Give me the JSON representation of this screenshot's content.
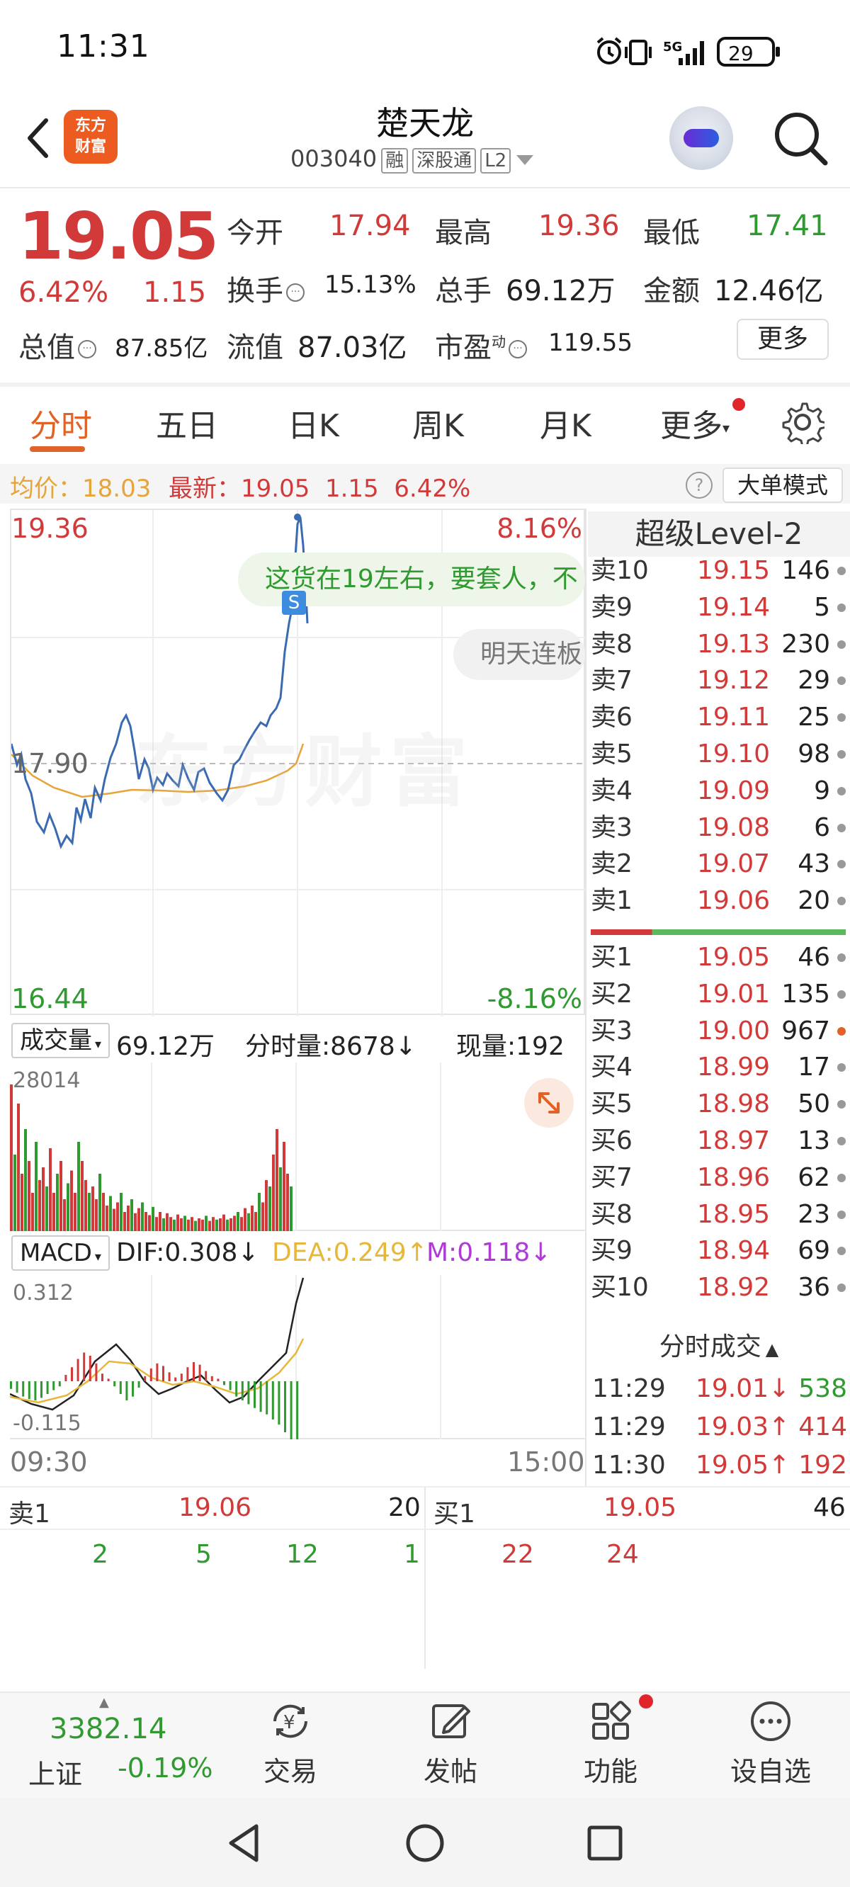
{
  "status_bar": {
    "time": "11:31",
    "network": "5G",
    "battery": "29"
  },
  "header": {
    "logo_text": "东方财富",
    "stock_name": "楚天龙",
    "stock_code": "003040",
    "tags": [
      "融",
      "深股通",
      "L2"
    ]
  },
  "quote": {
    "price": "19.05",
    "change_pct": "6.42%",
    "change_amt": "1.15",
    "open_label": "今开",
    "open": "17.94",
    "high_label": "最高",
    "high": "19.36",
    "low_label": "最低",
    "low": "17.41",
    "turnover_label": "换手",
    "turnover": "15.13%",
    "volume_label": "总手",
    "volume": "69.12万",
    "amount_label": "金额",
    "amount": "12.46亿",
    "mktcap_label": "总值",
    "mktcap": "87.85亿",
    "float_label": "流值",
    "float_cap": "87.03亿",
    "pe_label": "市盈",
    "pe_sup": "动",
    "pe": "119.55",
    "more_label": "更多"
  },
  "tabs": [
    "分时",
    "五日",
    "日K",
    "周K",
    "月K",
    "更多"
  ],
  "info_line": {
    "avg_label": "均价：18.03",
    "latest_label": "最新：",
    "latest": "19.05",
    "change": "1.15",
    "pct": "6.42%",
    "help": "?",
    "big_order_label": "大单模式"
  },
  "intraday_chart": {
    "y_top": "19.36",
    "y_top_pct": "8.16%",
    "y_mid": "17.90",
    "y_bottom": "16.44",
    "y_bottom_pct": "-8.16%",
    "watermark": "东方财富",
    "comment1": "这货在19左右，要套人，不",
    "comment2": "明天连板",
    "marker": "S"
  },
  "volume_panel": {
    "selector": "成交量",
    "total": "69.12万",
    "minute_label": "分时量:8678↓",
    "now_label": "现量:192",
    "max": "28014"
  },
  "macd_panel": {
    "selector": "MACD",
    "dif": "DIF:0.308↓",
    "dea": "DEA:0.249↑",
    "m": "M:0.118↓",
    "max": "0.312",
    "min": "-0.115"
  },
  "time_axis": {
    "start": "09:30",
    "end": "15:00"
  },
  "level2": {
    "title": "超级Level-2",
    "asks": [
      {
        "label": "卖10",
        "price": "19.15",
        "qty": "146"
      },
      {
        "label": "卖9",
        "price": "19.14",
        "qty": "5"
      },
      {
        "label": "卖8",
        "price": "19.13",
        "qty": "230"
      },
      {
        "label": "卖7",
        "price": "19.12",
        "qty": "29"
      },
      {
        "label": "卖6",
        "price": "19.11",
        "qty": "25"
      },
      {
        "label": "卖5",
        "price": "19.10",
        "qty": "98"
      },
      {
        "label": "卖4",
        "price": "19.09",
        "qty": "9"
      },
      {
        "label": "卖3",
        "price": "19.08",
        "qty": "6"
      },
      {
        "label": "卖2",
        "price": "19.07",
        "qty": "43"
      },
      {
        "label": "卖1",
        "price": "19.06",
        "qty": "20"
      }
    ],
    "bids": [
      {
        "label": "买1",
        "price": "19.05",
        "qty": "46"
      },
      {
        "label": "买2",
        "price": "19.01",
        "qty": "135"
      },
      {
        "label": "买3",
        "price": "19.00",
        "qty": "967"
      },
      {
        "label": "买4",
        "price": "18.99",
        "qty": "17"
      },
      {
        "label": "买5",
        "price": "18.98",
        "qty": "50"
      },
      {
        "label": "买6",
        "price": "18.97",
        "qty": "13"
      },
      {
        "label": "买7",
        "price": "18.96",
        "qty": "62"
      },
      {
        "label": "买8",
        "price": "18.95",
        "qty": "23"
      },
      {
        "label": "买9",
        "price": "18.94",
        "qty": "69"
      },
      {
        "label": "买10",
        "price": "18.92",
        "qty": "36"
      }
    ],
    "trades_title": "分时成交",
    "trades": [
      {
        "time": "11:29",
        "price": "19.01↓",
        "vol": "538"
      },
      {
        "time": "11:29",
        "price": "19.03↑",
        "vol": "414"
      },
      {
        "time": "11:30",
        "price": "19.05↑",
        "vol": "192"
      }
    ]
  },
  "order_strip": {
    "ask_label": "卖1",
    "ask_price": "19.06",
    "ask_qty": "20",
    "bid_label": "买1",
    "bid_price": "19.05",
    "bid_qty": "46",
    "ask_orders": [
      "2",
      "5",
      "12",
      "1"
    ],
    "bid_orders": [
      "22",
      "24"
    ]
  },
  "bottom_nav": {
    "index_value": "3382.14",
    "index_name": "上证",
    "index_pct": "-0.19%",
    "items": [
      "交易",
      "发帖",
      "功能",
      "设自选"
    ]
  },
  "colors": {
    "up": "#d23a3a",
    "down": "#2f9a2f",
    "accent": "#e06226",
    "price_line": "#3a6ab0",
    "avg_line": "#e6a43a"
  }
}
